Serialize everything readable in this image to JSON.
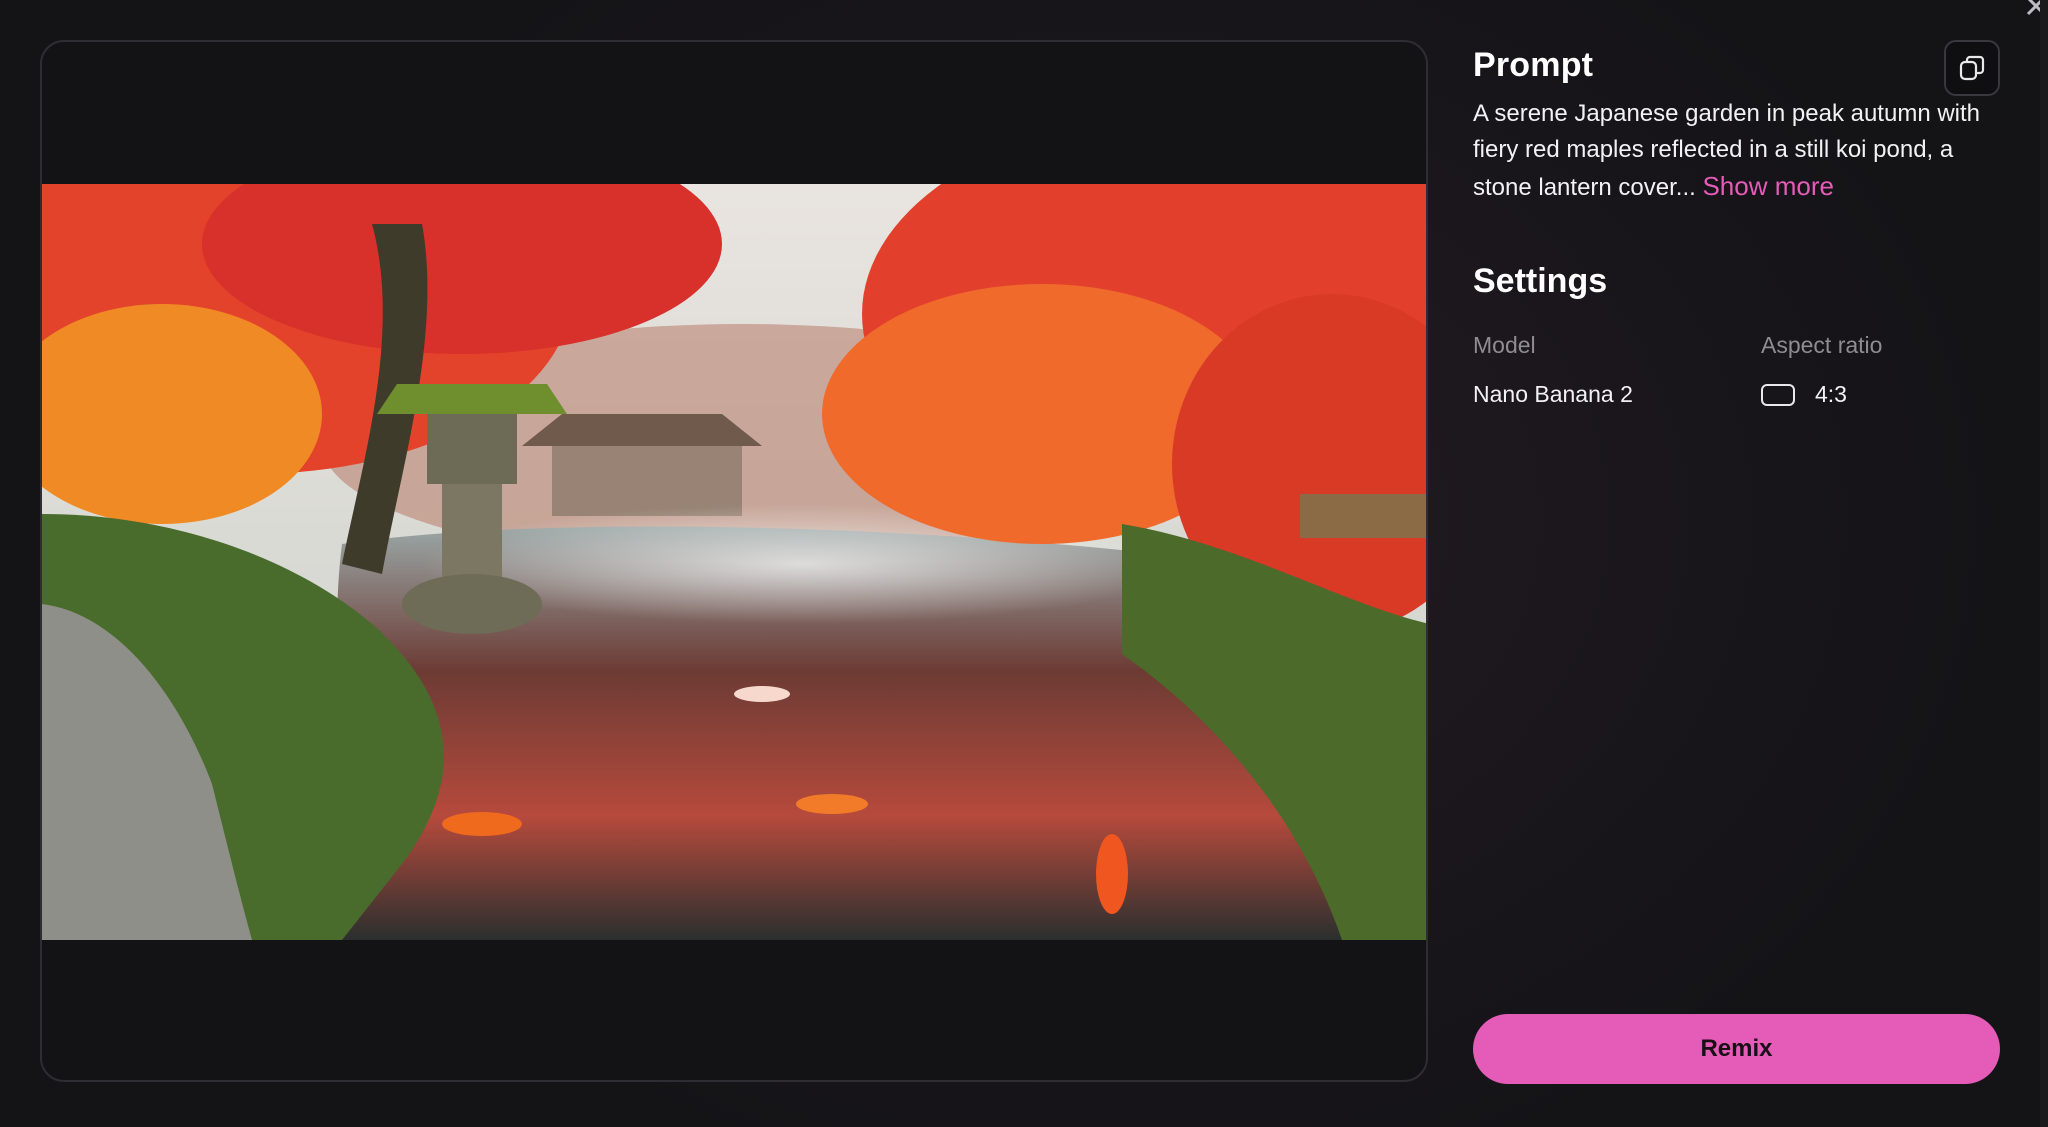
{
  "prompt": {
    "title": "Prompt",
    "text": "A serene Japanese garden in peak autumn with fiery red maples reflected in a still koi pond, a stone lantern cover...",
    "show_more_label": "Show more"
  },
  "settings": {
    "title": "Settings",
    "model_label": "Model",
    "model_value": "Nano Banana 2",
    "aspect_label": "Aspect ratio",
    "aspect_value": "4:3"
  },
  "actions": {
    "remix_label": "Remix"
  },
  "icons": {
    "copy": "copy-icon",
    "aspect": "aspect-ratio-icon",
    "close": "close-icon"
  },
  "colors": {
    "accent": "#e45bb8",
    "background": "#141316",
    "muted_text": "#8e8c93"
  }
}
